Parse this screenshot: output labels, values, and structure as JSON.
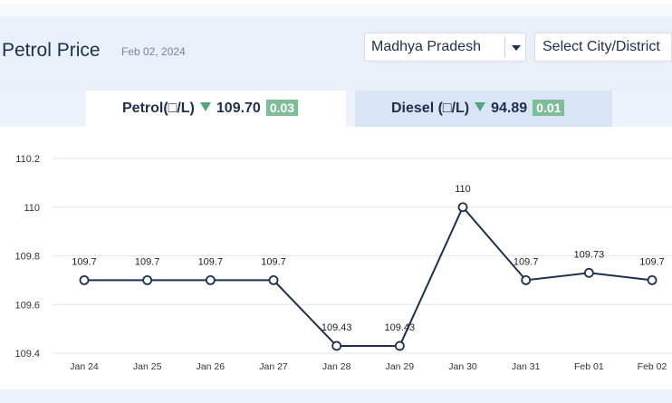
{
  "page": {
    "title": "Petrol Price",
    "date": "Feb 02, 2024",
    "state_select": "Madhya Pradesh",
    "city_select": "Select City/District"
  },
  "tabs": {
    "petrol": {
      "label": "Petrol(□/L)",
      "price": "109.70",
      "change": "0.03"
    },
    "diesel": {
      "label": "Diesel (□/L)",
      "price": "94.89",
      "change": "0.01"
    }
  },
  "colors": {
    "line": "#1e3050",
    "change_badge": "#7fbc99",
    "down_arrow": "#4fa57e"
  },
  "chart_data": {
    "type": "line",
    "categories": [
      "Jan 24",
      "Jan 25",
      "Jan 26",
      "Jan 27",
      "Jan 28",
      "Jan 29",
      "Jan 30",
      "Jan 31",
      "Feb 01",
      "Feb 02"
    ],
    "values": [
      109.7,
      109.7,
      109.7,
      109.7,
      109.43,
      109.43,
      110,
      109.7,
      109.73,
      109.7
    ],
    "data_labels": [
      "109.7",
      "109.7",
      "109.7",
      "109.7",
      "109.43",
      "109.43",
      "110",
      "109.7",
      "109.73",
      "109.7"
    ],
    "yticks": [
      "109.4",
      "109.6",
      "109.8",
      "110",
      "110.2"
    ],
    "ylim": [
      109.4,
      110.2
    ],
    "grid": true
  }
}
